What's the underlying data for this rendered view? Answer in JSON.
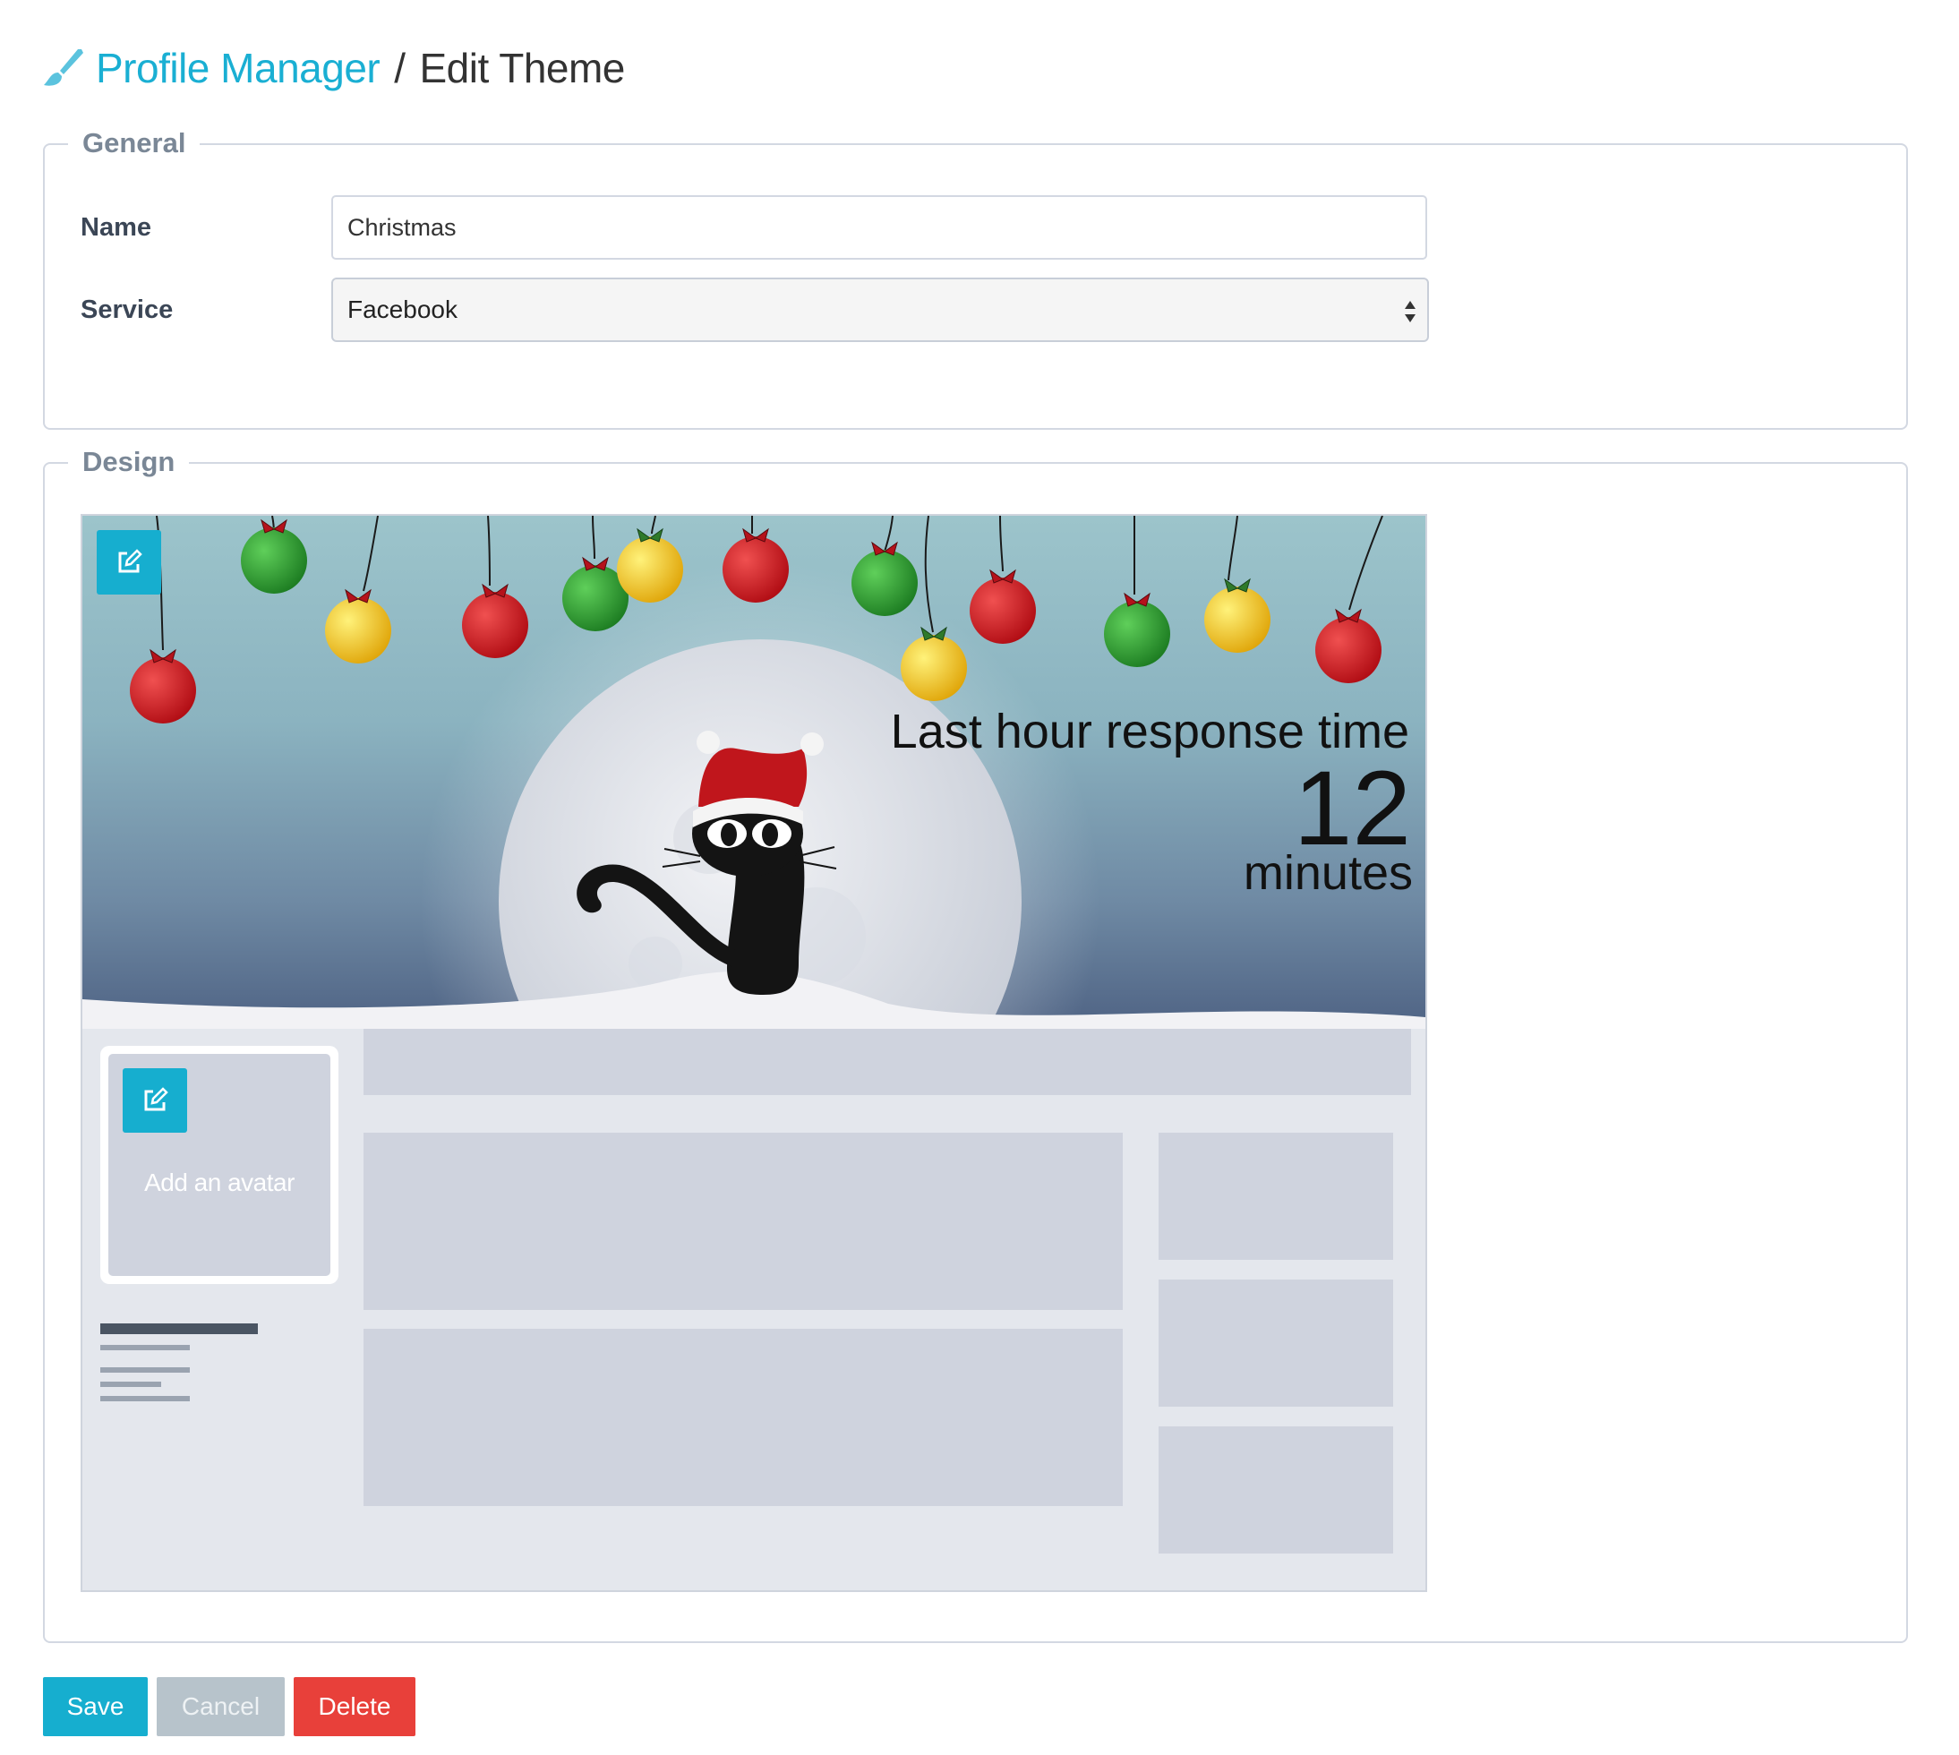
{
  "header": {
    "icon": "paintbrush-icon",
    "breadcrumb_link": "Profile Manager",
    "separator": "/",
    "current": "Edit Theme"
  },
  "general": {
    "legend": "General",
    "name_label": "Name",
    "name_value": "Christmas",
    "service_label": "Service",
    "service_value": "Facebook"
  },
  "design": {
    "legend": "Design",
    "cover_edit_icon": "edit-icon",
    "overlay": {
      "label": "Last hour response time",
      "value": "12",
      "unit": "minutes"
    },
    "avatar_edit_icon": "edit-icon",
    "avatar_text": "Add an avatar"
  },
  "actions": {
    "save": "Save",
    "cancel": "Cancel",
    "delete": "Delete"
  },
  "colors": {
    "accent": "#1aafd3",
    "save_bg": "#16aecf",
    "cancel_bg": "#b7c3cb",
    "delete_bg": "#e8403a"
  }
}
